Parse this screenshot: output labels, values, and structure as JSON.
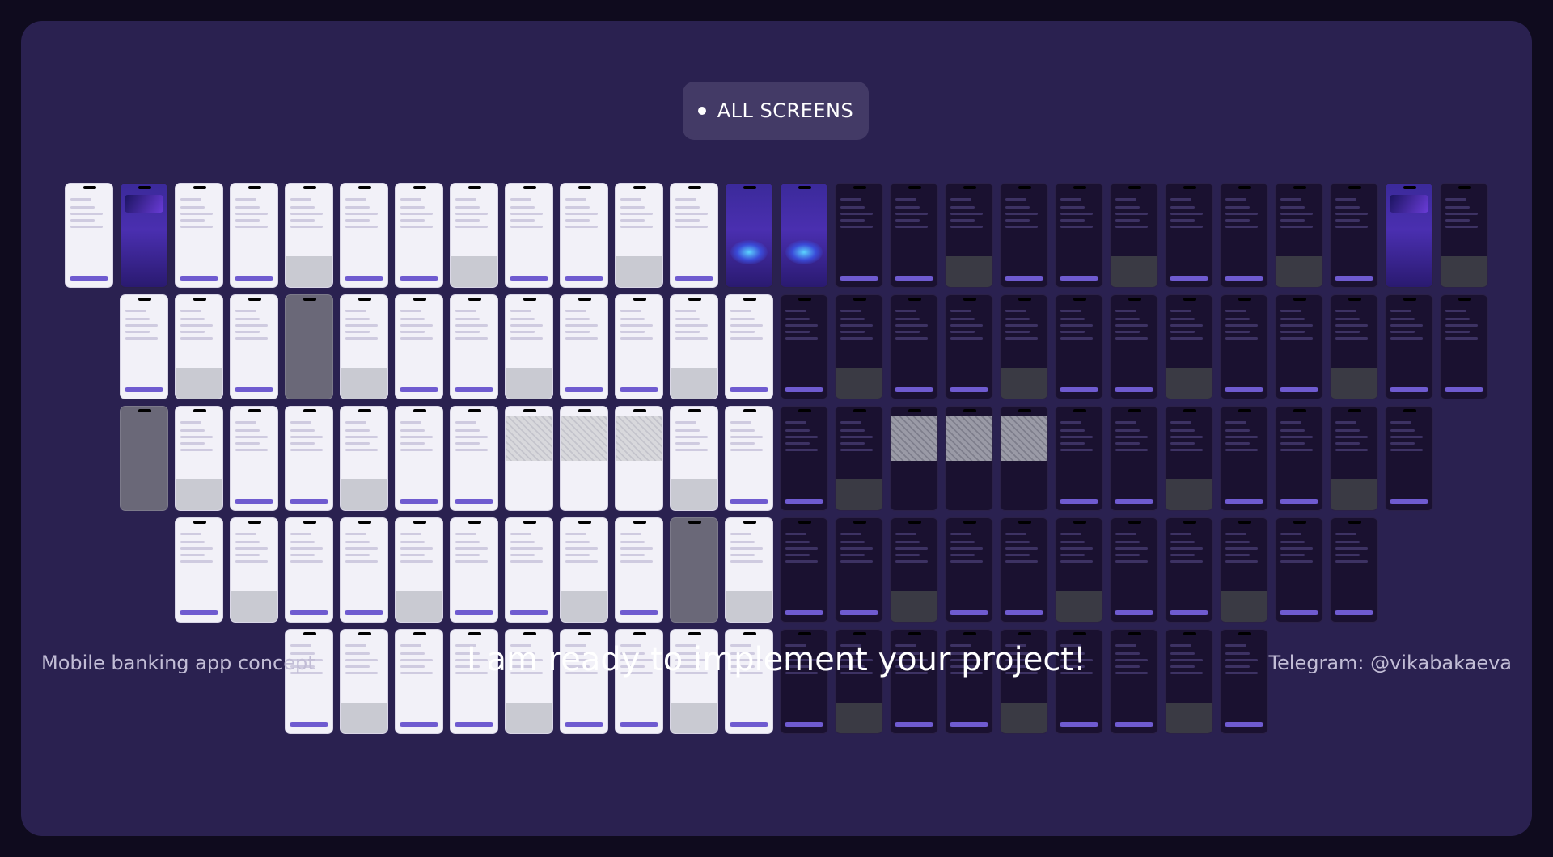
{
  "badge": {
    "label": "ALL SCREENS"
  },
  "footer": {
    "left": "Mobile banking app concept",
    "center": "I am ready to implement your project!",
    "right": "Telegram: @vikabakaeva"
  },
  "colors": {
    "background": "#0f0b1e",
    "panel": "#2a2150",
    "badge": "#433a66",
    "accent": "#6f5bd0",
    "text": "#ffffff",
    "muted_text": "#c2bdd6"
  },
  "screens": {
    "row1": [
      "light",
      "hero",
      "light",
      "light",
      "light",
      "light",
      "light",
      "light",
      "light",
      "light",
      "light",
      "light",
      "hero-glow",
      "hero-glow",
      "dark",
      "dark",
      "dark",
      "dark",
      "dark",
      "dark",
      "dark",
      "dark",
      "dark",
      "dark",
      "hero",
      "dark"
    ],
    "row2": [
      "light",
      "light",
      "light",
      "gray",
      "light",
      "light",
      "light",
      "light",
      "light",
      "light",
      "light",
      "light",
      "dark",
      "dark",
      "dark",
      "dark",
      "dark",
      "dark",
      "dark",
      "dark",
      "dark",
      "dark",
      "dark",
      "dark",
      "dark"
    ],
    "row3": [
      "gray",
      "light",
      "light",
      "light",
      "light",
      "light",
      "light",
      "map-light",
      "map-light",
      "map-light",
      "light",
      "light",
      "dark",
      "dark",
      "map-dark",
      "map-dark",
      "map-dark",
      "dark",
      "dark",
      "dark",
      "dark",
      "dark",
      "dark",
      "dark"
    ],
    "row4": [
      "light",
      "light",
      "light",
      "light",
      "light",
      "light",
      "light",
      "light",
      "light",
      "gray",
      "light",
      "dark",
      "dark",
      "dark",
      "dark",
      "dark",
      "dark",
      "dark",
      "dark",
      "dark",
      "dark",
      "dark"
    ],
    "row5": [
      "light",
      "light",
      "light",
      "light",
      "light",
      "light",
      "light",
      "light",
      "light",
      "dark",
      "dark",
      "dark",
      "dark",
      "dark",
      "dark",
      "dark",
      "dark",
      "dark"
    ]
  }
}
